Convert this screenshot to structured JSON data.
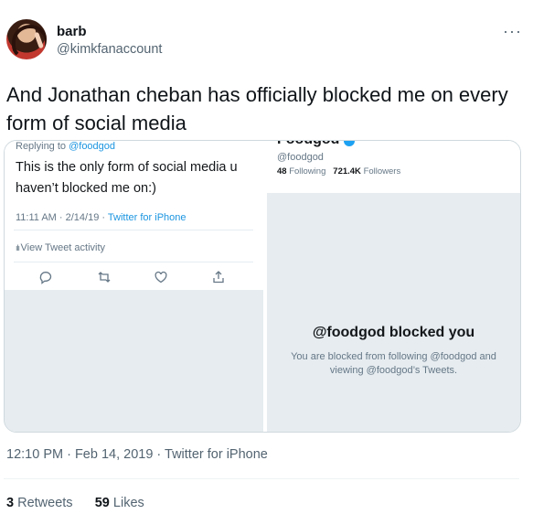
{
  "tweet": {
    "author_name": "barb",
    "author_handle": "@kimkfanaccount",
    "text": "And Jonathan cheban has officially blocked me on every form of social media",
    "timestamp": "12:10 PM · Feb 14, 2019 · Twitter for iPhone",
    "retweets_count": "3",
    "retweets_label": " Retweets",
    "likes_count": "59",
    "likes_label": " Likes",
    "more_glyph": "···"
  },
  "quoted_left": {
    "replying_prefix": "Replying to ",
    "replying_handle": "@foodgod",
    "text": "This is the only form of social media u haven’t blocked me on:)",
    "meta_time": "11:11 AM · 2/14/19 · ",
    "meta_source": "Twitter for iPhone",
    "activity_label": "View Tweet activity",
    "icons": [
      "reply-icon",
      "retweet-icon",
      "like-icon",
      "share-icon"
    ]
  },
  "quoted_right": {
    "cut_name": "Foodgod",
    "handle": "@foodgod",
    "following_count": "48",
    "following_label": "Following",
    "followers_count": "721.4K",
    "followers_label": "Followers",
    "blocked_title": "@foodgod blocked you",
    "blocked_desc": "You are blocked from following @foodgod and viewing @foodgod’s Tweets."
  },
  "colors": {
    "link_blue": "#1b95e0",
    "verified_blue": "#1da1f2",
    "placeholder_gray": "#e6ecf0"
  }
}
